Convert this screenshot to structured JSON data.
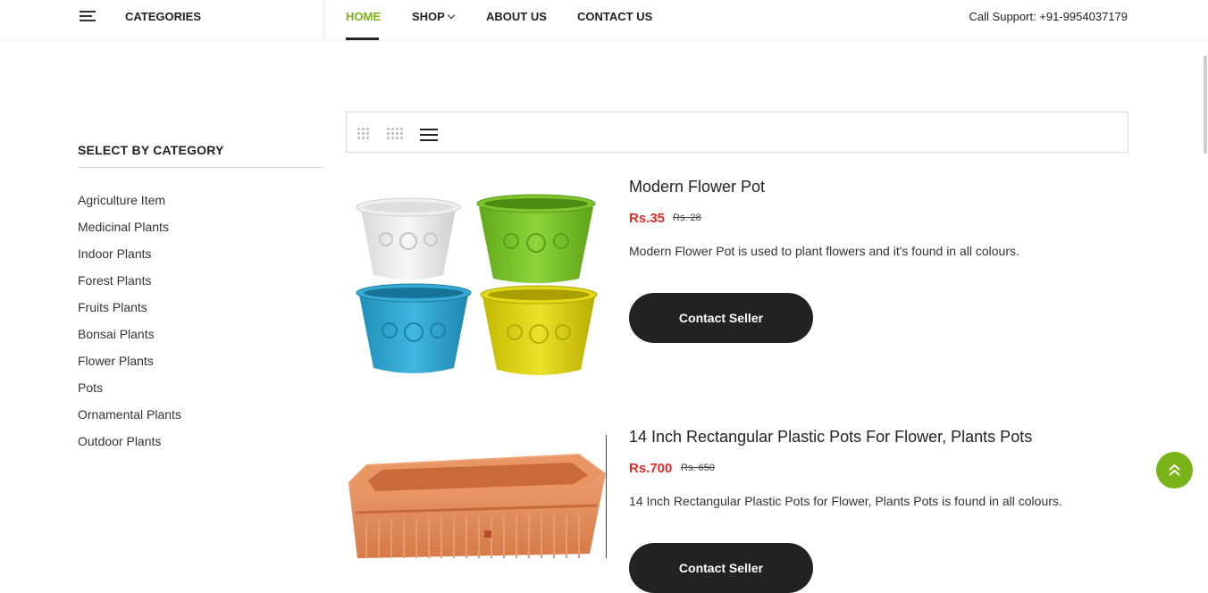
{
  "header": {
    "categories_label": "CATEGORIES",
    "nav": [
      {
        "label": "HOME",
        "active": true
      },
      {
        "label": "SHOP",
        "has_dropdown": true
      },
      {
        "label": "ABOUT US"
      },
      {
        "label": "CONTACT US"
      }
    ],
    "support": "Call Support: +91-9954037179"
  },
  "sidebar": {
    "title": "SELECT BY CATEGORY",
    "items": [
      "Agriculture Item",
      "Medicinal Plants",
      "Indoor Plants",
      "Forest Plants",
      "Fruits Plants",
      "Bonsai Plants",
      "Flower Plants",
      "Pots",
      "Ornamental Plants",
      "Outdoor Plants"
    ]
  },
  "toolbar": {
    "icons": [
      "grid-3-icon",
      "grid-4-icon",
      "list-view-icon"
    ]
  },
  "products": [
    {
      "title": "Modern Flower Pot",
      "price": "Rs.35",
      "old_price": "Rs. 28",
      "description": "Modern Flower Pot is used to plant flowers and it's found in all colours.",
      "button": "Contact Seller"
    },
    {
      "title": "14 Inch Rectangular Plastic Pots For Flower, Plants Pots",
      "price": "Rs.700",
      "old_price": "Rs. 650",
      "description": "14 Inch Rectangular Plastic Pots for Flower, Plants Pots is found in all colours.",
      "button": "Contact Seller"
    }
  ],
  "colors": {
    "accent": "#7ab317",
    "price": "#e02b27",
    "button": "#222222"
  }
}
